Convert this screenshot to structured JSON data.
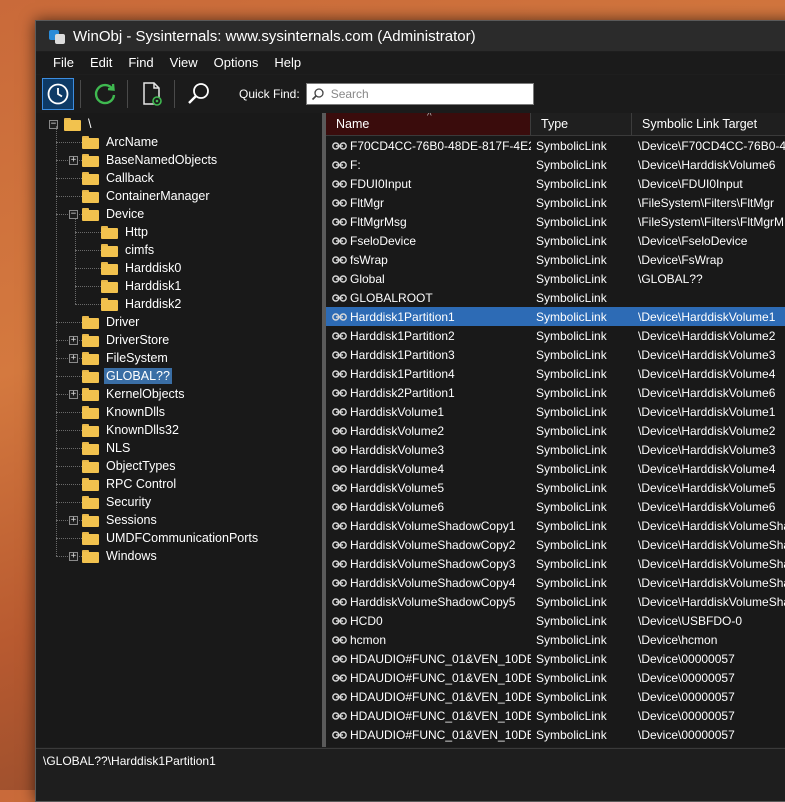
{
  "window": {
    "title": "WinObj - Sysinternals: www.sysinternals.com (Administrator)"
  },
  "menu": [
    "File",
    "Edit",
    "Find",
    "View",
    "Options",
    "Help"
  ],
  "toolbar": {
    "quick_find_label": "Quick Find:",
    "search_placeholder": "Search",
    "icons": [
      "clock-icon",
      "refresh-icon",
      "properties-icon",
      "find-icon"
    ]
  },
  "tree": {
    "root": "\\",
    "items": [
      {
        "label": "ArcName",
        "level": 1,
        "expander": "none"
      },
      {
        "label": "BaseNamedObjects",
        "level": 1,
        "expander": "plus"
      },
      {
        "label": "Callback",
        "level": 1,
        "expander": "none"
      },
      {
        "label": "ContainerManager",
        "level": 1,
        "expander": "none"
      },
      {
        "label": "Device",
        "level": 1,
        "expander": "minus"
      },
      {
        "label": "Http",
        "level": 2,
        "expander": "none"
      },
      {
        "label": "cimfs",
        "level": 2,
        "expander": "none"
      },
      {
        "label": "Harddisk0",
        "level": 2,
        "expander": "none"
      },
      {
        "label": "Harddisk1",
        "level": 2,
        "expander": "none"
      },
      {
        "label": "Harddisk2",
        "level": 2,
        "expander": "none"
      },
      {
        "label": "Driver",
        "level": 1,
        "expander": "none"
      },
      {
        "label": "DriverStore",
        "level": 1,
        "expander": "plus"
      },
      {
        "label": "FileSystem",
        "level": 1,
        "expander": "plus"
      },
      {
        "label": "GLOBAL??",
        "level": 1,
        "expander": "none",
        "selected": true
      },
      {
        "label": "KernelObjects",
        "level": 1,
        "expander": "plus"
      },
      {
        "label": "KnownDlls",
        "level": 1,
        "expander": "none"
      },
      {
        "label": "KnownDlls32",
        "level": 1,
        "expander": "none"
      },
      {
        "label": "NLS",
        "level": 1,
        "expander": "none"
      },
      {
        "label": "ObjectTypes",
        "level": 1,
        "expander": "none"
      },
      {
        "label": "RPC Control",
        "level": 1,
        "expander": "none"
      },
      {
        "label": "Security",
        "level": 1,
        "expander": "none"
      },
      {
        "label": "Sessions",
        "level": 1,
        "expander": "plus"
      },
      {
        "label": "UMDFCommunicationPorts",
        "level": 1,
        "expander": "none"
      },
      {
        "label": "Windows",
        "level": 1,
        "expander": "plus"
      }
    ]
  },
  "list": {
    "columns": [
      "Name",
      "Type",
      "Symbolic Link Target"
    ],
    "rows": [
      {
        "name": "F70CD4CC-76B0-48DE-817F-4E2...",
        "type": "SymbolicLink",
        "target": "\\Device\\F70CD4CC-76B0-48"
      },
      {
        "name": "F:",
        "type": "SymbolicLink",
        "target": "\\Device\\HarddiskVolume6"
      },
      {
        "name": "FDUI0Input",
        "type": "SymbolicLink",
        "target": "\\Device\\FDUI0Input"
      },
      {
        "name": "FltMgr",
        "type": "SymbolicLink",
        "target": "\\FileSystem\\Filters\\FltMgr"
      },
      {
        "name": "FltMgrMsg",
        "type": "SymbolicLink",
        "target": "\\FileSystem\\Filters\\FltMgrM"
      },
      {
        "name": "FseloDevice",
        "type": "SymbolicLink",
        "target": "\\Device\\FseloDevice"
      },
      {
        "name": "fsWrap",
        "type": "SymbolicLink",
        "target": "\\Device\\FsWrap"
      },
      {
        "name": "Global",
        "type": "SymbolicLink",
        "target": "\\GLOBAL??"
      },
      {
        "name": "GLOBALROOT",
        "type": "SymbolicLink",
        "target": ""
      },
      {
        "name": "Harddisk1Partition1",
        "type": "SymbolicLink",
        "target": "\\Device\\HarddiskVolume1",
        "selected": true
      },
      {
        "name": "Harddisk1Partition2",
        "type": "SymbolicLink",
        "target": "\\Device\\HarddiskVolume2"
      },
      {
        "name": "Harddisk1Partition3",
        "type": "SymbolicLink",
        "target": "\\Device\\HarddiskVolume3"
      },
      {
        "name": "Harddisk1Partition4",
        "type": "SymbolicLink",
        "target": "\\Device\\HarddiskVolume4"
      },
      {
        "name": "Harddisk2Partition1",
        "type": "SymbolicLink",
        "target": "\\Device\\HarddiskVolume6"
      },
      {
        "name": "HarddiskVolume1",
        "type": "SymbolicLink",
        "target": "\\Device\\HarddiskVolume1"
      },
      {
        "name": "HarddiskVolume2",
        "type": "SymbolicLink",
        "target": "\\Device\\HarddiskVolume2"
      },
      {
        "name": "HarddiskVolume3",
        "type": "SymbolicLink",
        "target": "\\Device\\HarddiskVolume3"
      },
      {
        "name": "HarddiskVolume4",
        "type": "SymbolicLink",
        "target": "\\Device\\HarddiskVolume4"
      },
      {
        "name": "HarddiskVolume5",
        "type": "SymbolicLink",
        "target": "\\Device\\HarddiskVolume5"
      },
      {
        "name": "HarddiskVolume6",
        "type": "SymbolicLink",
        "target": "\\Device\\HarddiskVolume6"
      },
      {
        "name": "HarddiskVolumeShadowCopy1",
        "type": "SymbolicLink",
        "target": "\\Device\\HarddiskVolumeSha"
      },
      {
        "name": "HarddiskVolumeShadowCopy2",
        "type": "SymbolicLink",
        "target": "\\Device\\HarddiskVolumeSha"
      },
      {
        "name": "HarddiskVolumeShadowCopy3",
        "type": "SymbolicLink",
        "target": "\\Device\\HarddiskVolumeSha"
      },
      {
        "name": "HarddiskVolumeShadowCopy4",
        "type": "SymbolicLink",
        "target": "\\Device\\HarddiskVolumeSha"
      },
      {
        "name": "HarddiskVolumeShadowCopy5",
        "type": "SymbolicLink",
        "target": "\\Device\\HarddiskVolumeSha"
      },
      {
        "name": "HCD0",
        "type": "SymbolicLink",
        "target": "\\Device\\USBFDO-0"
      },
      {
        "name": "hcmon",
        "type": "SymbolicLink",
        "target": "\\Device\\hcmon"
      },
      {
        "name": "HDAUDIO#FUNC_01&VEN_10DE...",
        "type": "SymbolicLink",
        "target": "\\Device\\00000057"
      },
      {
        "name": "HDAUDIO#FUNC_01&VEN_10DE...",
        "type": "SymbolicLink",
        "target": "\\Device\\00000057"
      },
      {
        "name": "HDAUDIO#FUNC_01&VEN_10DE...",
        "type": "SymbolicLink",
        "target": "\\Device\\00000057"
      },
      {
        "name": "HDAUDIO#FUNC_01&VEN_10DE...",
        "type": "SymbolicLink",
        "target": "\\Device\\00000057"
      },
      {
        "name": "HDAUDIO#FUNC_01&VEN_10DE...",
        "type": "SymbolicLink",
        "target": "\\Device\\00000057"
      }
    ]
  },
  "status": {
    "path": "\\GLOBAL??\\Harddisk1Partition1"
  },
  "colors": {
    "selection": "#2d6bb5",
    "tree_selection": "#3a6ea5",
    "folder": "#f2c24e",
    "sorted_header": "#3a0c0c"
  }
}
